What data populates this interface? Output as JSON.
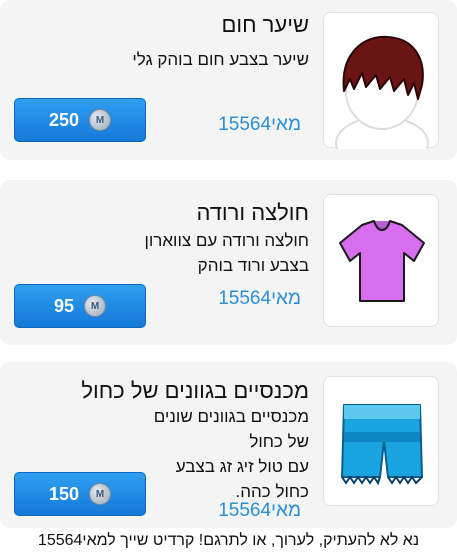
{
  "items": [
    {
      "title": "שיער חום",
      "description": [
        "שיער בצבע חום בוהק גלי"
      ],
      "author": "מאי15564",
      "price": "250",
      "coin_symbol": "M",
      "thumb_icon": "brown-hair-icon"
    },
    {
      "title": "חולצה ורודה",
      "description": [
        "חולצה ורודה עם צווארון",
        "בצבע ורוד בוהק"
      ],
      "author": "מאי15564",
      "price": "95",
      "coin_symbol": "M",
      "thumb_icon": "pink-shirt-icon"
    },
    {
      "title": "מכנסיים בגוונים של כחול",
      "description": [
        "מכנסיים בגוונים שונים",
        "של כחול",
        "עם טול זיג זג בצבע",
        "כחול כהה."
      ],
      "author": "מאי15564",
      "price": "150",
      "coin_symbol": "M",
      "thumb_icon": "blue-shorts-icon"
    }
  ],
  "footer": "נא לא להעתיק, לערוך, או לתרגם! קרדיט שייך למאי15564",
  "colors": {
    "button": "#1b86e2",
    "author_link": "#2a8fd6",
    "card_bg": "#f4f4f4"
  }
}
